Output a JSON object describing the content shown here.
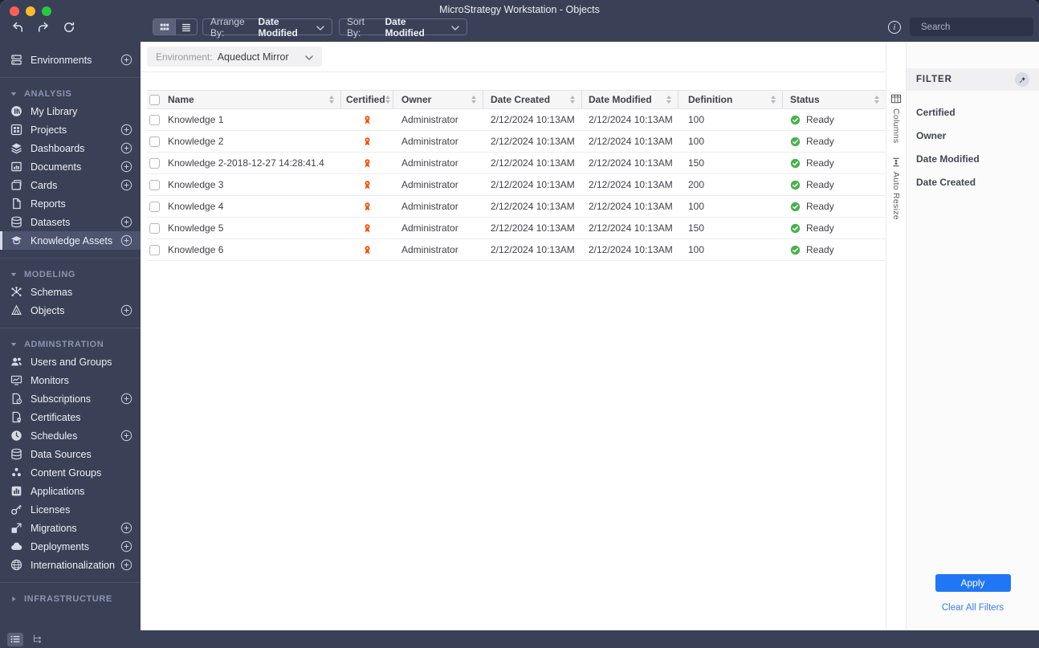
{
  "window": {
    "title": "MicroStrategy Workstation - Objects"
  },
  "toolbar": {
    "arrange_by": {
      "label": "Arrange By:",
      "value": "Date Modified"
    },
    "sort_by": {
      "label": "Sort By:",
      "value": "Date Modified"
    },
    "search_placeholder": "Search"
  },
  "environment_bar": {
    "label": "Environment:",
    "value": "Aqueduct Mirror"
  },
  "sidebar": {
    "environments": "Environments",
    "selected_item": "Knowledge Assets",
    "sections": [
      {
        "header": "ANALYSIS",
        "items": [
          "My Library",
          "Projects",
          "Dashboards",
          "Documents",
          "Cards",
          "Reports",
          "Datasets",
          "Knowledge Assets"
        ]
      },
      {
        "header": "MODELING",
        "items": [
          "Schemas",
          "Objects"
        ]
      },
      {
        "header": "ADMINSTRATION",
        "items": [
          "Users and Groups",
          "Monitors",
          "Subscriptions",
          "Certificates",
          "Schedules",
          "Data Sources",
          "Content Groups",
          "Applications",
          "Licenses",
          "Migrations",
          "Deployments",
          "Internationalization"
        ]
      },
      {
        "header": "INFRASTRUCTURE",
        "items": []
      }
    ]
  },
  "table": {
    "columns": [
      "Name",
      "Certified",
      "Owner",
      "Date Created",
      "Date Modified",
      "Definition",
      "Status"
    ],
    "rows": [
      {
        "name": "Knowledge 1",
        "certified": true,
        "owner": "Administrator",
        "date_created": "2/12/2024 10:13AM",
        "date_modified": "2/12/2024 10:13AM",
        "definition": "100",
        "status": "Ready"
      },
      {
        "name": "Knowledge 2",
        "certified": true,
        "owner": "Administrator",
        "date_created": "2/12/2024 10:13AM",
        "date_modified": "2/12/2024 10:13AM",
        "definition": "100",
        "status": "Ready"
      },
      {
        "name": "Knowledge 2-2018-12-27 14:28:41.4",
        "certified": true,
        "owner": "Administrator",
        "date_created": "2/12/2024 10:13AM",
        "date_modified": "2/12/2024 10:13AM",
        "definition": "150",
        "status": "Ready"
      },
      {
        "name": "Knowledge 3",
        "certified": true,
        "owner": "Administrator",
        "date_created": "2/12/2024 10:13AM",
        "date_modified": "2/12/2024 10:13AM",
        "definition": "200",
        "status": "Ready"
      },
      {
        "name": "Knowledge 4",
        "certified": true,
        "owner": "Administrator",
        "date_created": "2/12/2024 10:13AM",
        "date_modified": "2/12/2024 10:13AM",
        "definition": "100",
        "status": "Ready"
      },
      {
        "name": "Knowledge 5",
        "certified": true,
        "owner": "Administrator",
        "date_created": "2/12/2024 10:13AM",
        "date_modified": "2/12/2024 10:13AM",
        "definition": "150",
        "status": "Ready"
      },
      {
        "name": "Knowledge 6",
        "certified": true,
        "owner": "Administrator",
        "date_created": "2/12/2024 10:13AM",
        "date_modified": "2/12/2024 10:13AM",
        "definition": "100",
        "status": "Ready"
      }
    ]
  },
  "side_strip": {
    "columns": "Columns",
    "auto_resize": "Auto Resize"
  },
  "filter_panel": {
    "title": "FILTER",
    "items": [
      "Certified",
      "Owner",
      "Date Modified",
      "Date Created"
    ],
    "apply": "Apply",
    "clear": "Clear All Filters"
  },
  "colors": {
    "chrome_dark": "#3A4056",
    "certified_badge": "#F4510B",
    "status_ready": "#4CAF50",
    "apply_button": "#2176F3",
    "link": "#3B7DF0"
  }
}
